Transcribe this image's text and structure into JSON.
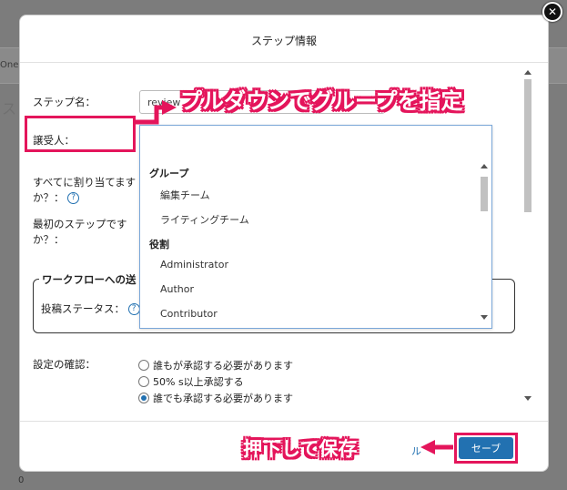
{
  "background": {
    "left_tab": "One",
    "corner_char": "ス",
    "bottom_number": "0"
  },
  "dialog": {
    "title": "ステップ情報",
    "close_glyph": "✕"
  },
  "form": {
    "step_name_label": "ステップ名：",
    "step_name_value": "review",
    "assignee_label": "譲受人：",
    "assign_all_label_line1": "すべてに割り当てます",
    "assign_all_label_line2": "か？：",
    "first_step_label_line1": "最初のステップです",
    "first_step_label_line2": "か？：",
    "help_glyph": "?",
    "fieldset_legend": "ワークフローへの送",
    "post_status_label": "投稿ステータス：",
    "settings_label": "設定の確認：",
    "radio_options": [
      {
        "label": "誰もが承認する必要があります",
        "checked": false
      },
      {
        "label": "50% s以上承認する",
        "checked": false
      },
      {
        "label": "誰でも承認する必要があります",
        "checked": true
      }
    ]
  },
  "dropdown": {
    "groups": [
      {
        "label": "グループ",
        "items": [
          "編集チーム",
          "ライティングチーム"
        ]
      },
      {
        "label": "役割",
        "items": [
          "Administrator",
          "Author",
          "Contributor"
        ]
      }
    ]
  },
  "footer": {
    "cancel_label": "ル",
    "save_label": "セーブ"
  },
  "annotations": {
    "dropdown_note": "プルダウンでグループを指定",
    "save_note": "押下して保存",
    "accent_color": "#e4155b"
  }
}
